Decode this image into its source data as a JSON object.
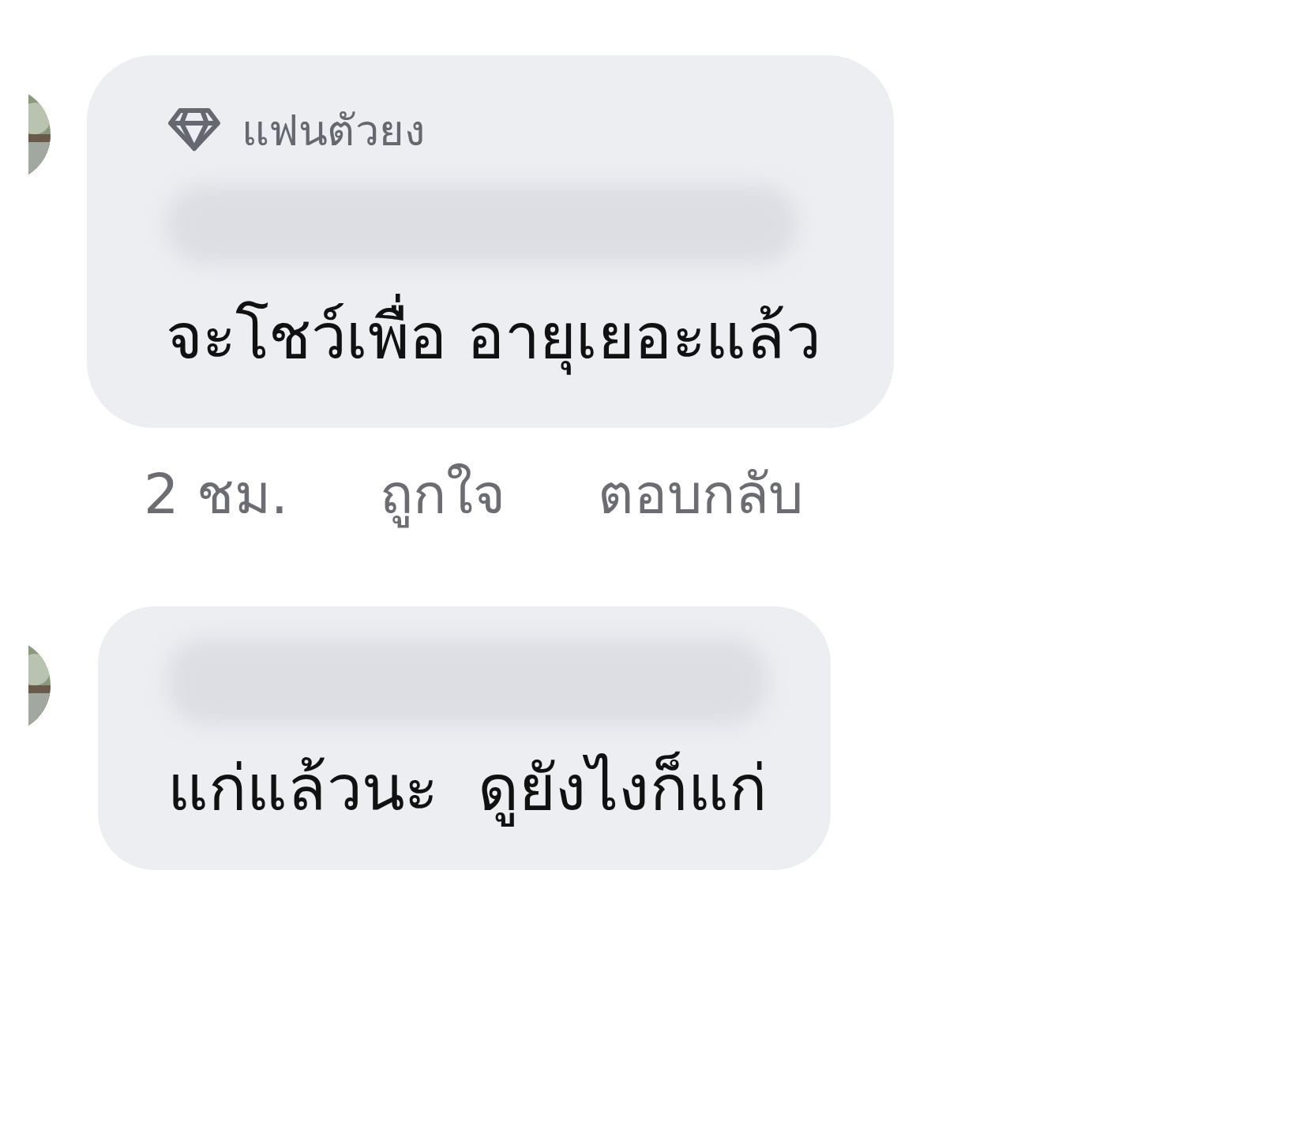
{
  "comments": [
    {
      "badge": "แฟนตัวยง",
      "text": "จะโชว์เพื่อ อายุเยอะแล้ว",
      "time": "2 ชม.",
      "actions": [
        "ถูกใจ",
        "ตอบกลับ"
      ]
    },
    {
      "text": "แก่แล้วนะ  ดูยังไงก็แก่"
    }
  ]
}
